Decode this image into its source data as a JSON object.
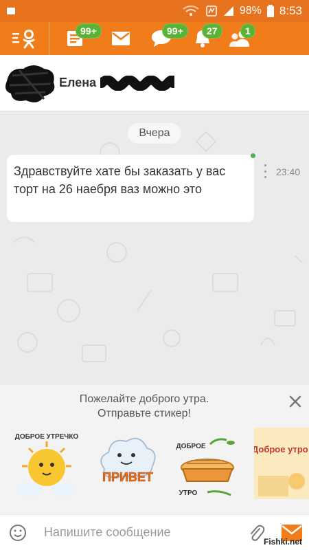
{
  "status_bar": {
    "battery": "98%",
    "time": "8:53"
  },
  "top_bar": {
    "badges": {
      "feed": "99+",
      "messages": "99+",
      "notifications": "27",
      "friends": "1"
    }
  },
  "chat_header": {
    "contact_name": "Елена"
  },
  "chat": {
    "date_separator": "Вчера",
    "messages": [
      {
        "text": "Здравствуйте хате бы заказать у вас торт на 26 наебря ваз можно это",
        "time": "23:40"
      }
    ]
  },
  "sticker_suggestion": {
    "line1": "Пожелайте доброго утра.",
    "line2": "Отправьте стикер!",
    "stickers": [
      {
        "name": "sun-sticker",
        "text": "ДОБРОЕ УТРЕЧКО"
      },
      {
        "name": "cloud-sticker",
        "text": "ПРИВЕТ"
      },
      {
        "name": "pie-sticker",
        "text_top": "ДОБРОЕ",
        "text_bottom": "УТРО"
      },
      {
        "name": "card-sticker",
        "text": "Доброе утро!"
      }
    ]
  },
  "input_bar": {
    "placeholder": "Напишите сообщение"
  },
  "watermark": "Fishki.net",
  "colors": {
    "brand_orange": "#f07c1a",
    "badge_green": "#5ab334",
    "chat_bg": "#ebebeb"
  }
}
